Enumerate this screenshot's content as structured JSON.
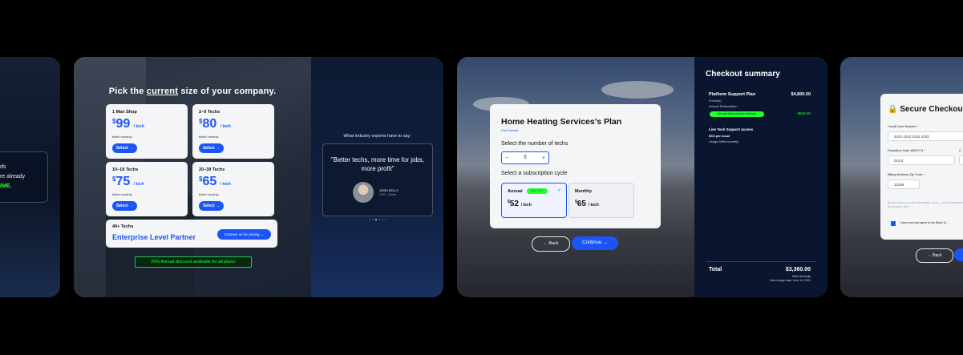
{
  "panel_left": {
    "line1": "ds",
    "line2": "re already",
    "line3": "IME."
  },
  "pricing": {
    "title_prefix": "Pick the ",
    "title_underlined": "current",
    "title_suffix": " size of your company.",
    "plans": [
      {
        "name": "1 Man Shop",
        "currency": "$",
        "price": "99",
        "unit": "/ tech",
        "billed": "billed monthly",
        "select": "Select →"
      },
      {
        "name": "2–9 Techs",
        "currency": "$",
        "price": "80",
        "unit": "/ tech",
        "billed": "billed monthly",
        "select": "Select →"
      },
      {
        "name": "10–19 Techs",
        "currency": "$",
        "price": "75",
        "unit": "/ tech",
        "billed": "billed monthly",
        "select": "Select →"
      },
      {
        "name": "20–39 Techs",
        "currency": "$",
        "price": "65",
        "unit": "/ tech",
        "billed": "billed monthly",
        "select": "Select →"
      }
    ],
    "enterprise": {
      "name": "40+ Techs",
      "title": "Enterprise Level Partner",
      "button": "Connect us for pricing →"
    },
    "discount": "20% Annual discount available for all plans!",
    "experts_heading": "What industry experts have to say:",
    "quote": "\"Better techs, more time for jobs, more profit\"",
    "person_name": "JOSH KELLY",
    "person_role": "COO - Clover"
  },
  "plan": {
    "title": "Home Heating Services's Plan",
    "details_link": "Plan Details",
    "techs_label": "Select the number of techs",
    "minus": "−",
    "count": "5",
    "plus": "+",
    "cycle_label": "Select a subscription cycle",
    "annual": {
      "name": "Annual",
      "badge": "Save 20%",
      "currency": "$",
      "price": "52",
      "unit": "/ tech"
    },
    "monthly": {
      "name": "Monthly",
      "currency": "$",
      "price": "65",
      "unit": "/ tech"
    },
    "back": "← Back",
    "continue": "Continue →"
  },
  "summary": {
    "title": "Checkout summary",
    "platform": "Platform Support Plan",
    "platform_price": "$4,800.00",
    "techs": "5 tech(s)",
    "annual_sub": "Annual Subscription",
    "savings_badge": "Annual Subscription Savings",
    "savings_value": "- $640.00",
    "live": "Live Tech Support access",
    "per_issue": "$XX per issue",
    "usage": "Usage billed monthly",
    "total_label": "Total",
    "total_value": "$3,360.00",
    "billed_annually": "Billed Annually",
    "next_charge": "Next charge date: June 14, 2024"
  },
  "secure": {
    "title": "Secure Checkout",
    "card_label": "Credit Card Number",
    "card_value": "4242 4242 4242 4242",
    "exp_label": "Expiration Date (MM/YY)",
    "exp_value": "01/24",
    "cvc_label": "C",
    "zip_label": "Billing Address Zip Code",
    "zip_value": "12345",
    "fine_print": "By providing your card information, you a... for future payments in accordance with t...",
    "agree": "I have read and agree to the Black To...",
    "back": "← Back"
  }
}
